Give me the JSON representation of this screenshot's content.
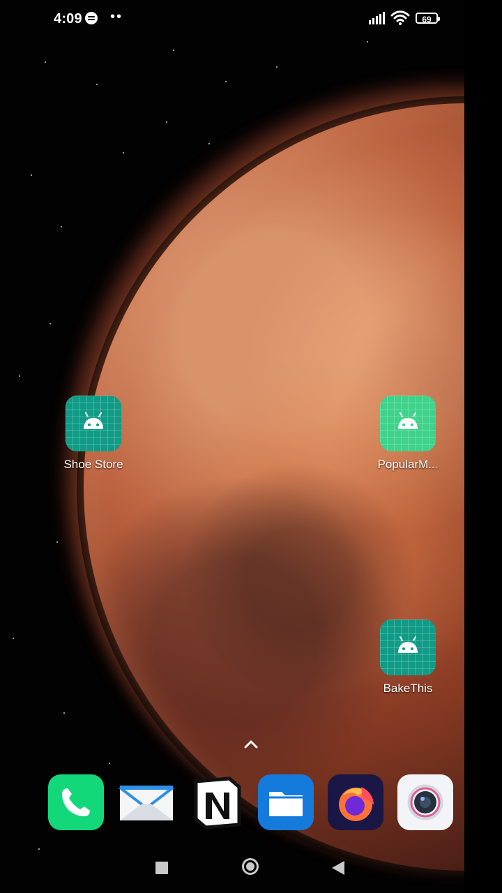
{
  "status_bar": {
    "time": "4:09",
    "notification_icons": [
      "spotify-icon",
      "more-icon"
    ],
    "system_icons": [
      "signal-icon",
      "wifi-icon",
      "battery-icon"
    ],
    "battery_level": "69"
  },
  "home_screen": {
    "apps": [
      {
        "label": "Shoe Store",
        "icon": "android-icon"
      },
      {
        "label": "PopularM...",
        "icon": "android-icon"
      },
      {
        "label": "BakeThis",
        "icon": "android-icon"
      }
    ]
  },
  "dock": {
    "apps": [
      {
        "label": "Phone",
        "icon": "phone-icon"
      },
      {
        "label": "Mail",
        "icon": "mail-icon"
      },
      {
        "label": "Notion",
        "icon": "notion-icon"
      },
      {
        "label": "Files",
        "icon": "folder-icon"
      },
      {
        "label": "Firefox",
        "icon": "firefox-icon"
      },
      {
        "label": "Camera",
        "icon": "camera-icon"
      }
    ]
  },
  "navigation": {
    "recent_icon": "recent-apps-icon",
    "home_icon": "home-icon",
    "back_icon": "back-icon"
  }
}
